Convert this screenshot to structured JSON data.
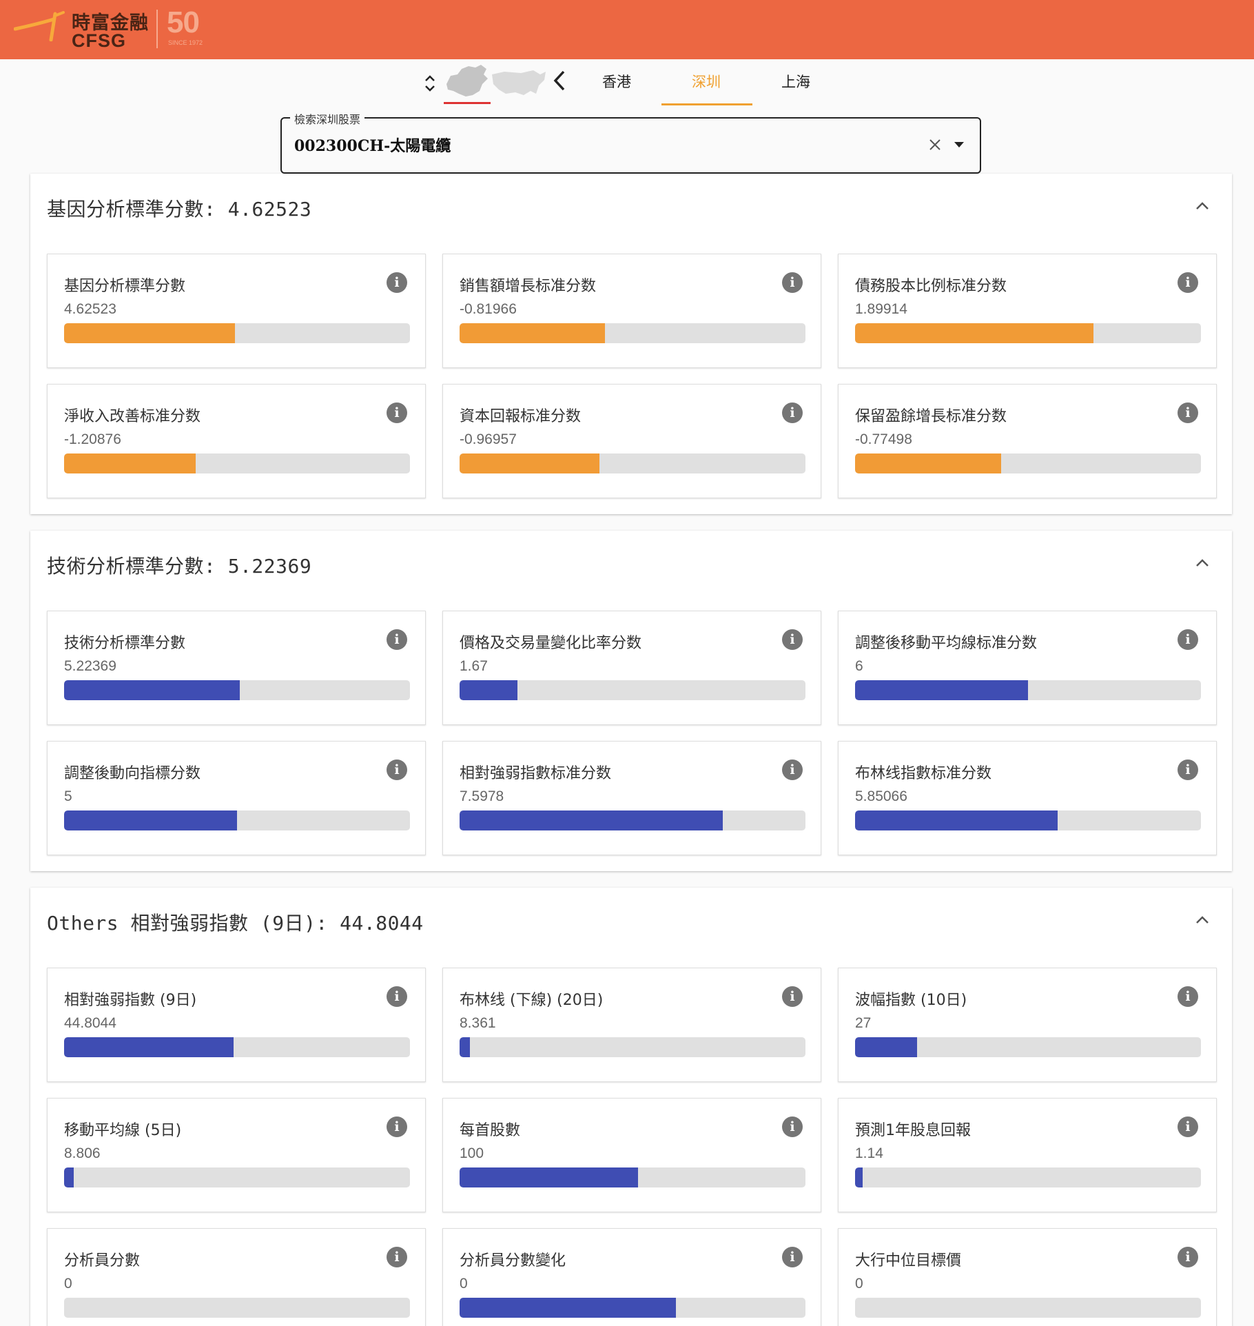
{
  "header": {
    "logo_cn": "時富金融",
    "logo_en": "CFSG",
    "logo_50": "50",
    "logo_since": "SINCE 1972"
  },
  "tabs": {
    "items": [
      {
        "label": "香港"
      },
      {
        "label": "深圳"
      },
      {
        "label": "上海"
      }
    ],
    "active": "深圳"
  },
  "search": {
    "legend": "檢索深圳股票",
    "value": "002300CH-太陽電纜"
  },
  "colors": {
    "header": "#ec6742",
    "accent": "#f0a030",
    "bar_orange": "#f19b36",
    "bar_blue": "#3f4db3"
  },
  "sections": [
    {
      "title": "基因分析標準分數: 4.62523",
      "bar_color": "orange",
      "cards": [
        {
          "label": "基因分析標準分數",
          "value": "4.62523",
          "fill": 0.495
        },
        {
          "label": "銷售額增長标准分数",
          "value": "-0.81966",
          "fill": 0.42
        },
        {
          "label": "債務股本比例标准分数",
          "value": "1.89914",
          "fill": 0.69
        },
        {
          "label": "淨收入改善标准分数",
          "value": "-1.20876",
          "fill": 0.38
        },
        {
          "label": "資本回報标准分数",
          "value": "-0.96957",
          "fill": 0.405
        },
        {
          "label": "保留盈餘增長标准分数",
          "value": "-0.77498",
          "fill": 0.422
        }
      ]
    },
    {
      "title": "技術分析標準分數: 5.22369",
      "bar_color": "blue",
      "cards": [
        {
          "label": "技術分析標準分數",
          "value": "5.22369",
          "fill": 0.508
        },
        {
          "label": "價格及交易量變化比率分数",
          "value": "1.67",
          "fill": 0.167
        },
        {
          "label": "調整後移動平均線标准分数",
          "value": "6",
          "fill": 0.5
        },
        {
          "label": "調整後動向指標分数",
          "value": "5",
          "fill": 0.5
        },
        {
          "label": "相對強弱指數标准分数",
          "value": "7.5978",
          "fill": 0.76
        },
        {
          "label": "布林线指數标准分数",
          "value": "5.85066",
          "fill": 0.585
        }
      ]
    },
    {
      "title": "Others 相對強弱指數 (9日): 44.8044",
      "bar_color": "blue",
      "cards": [
        {
          "label": "相對強弱指數 (9日)",
          "value": "44.8044",
          "fill": 0.49
        },
        {
          "label": "布林线 (下線) (20日)",
          "value": "8.361",
          "fill": 0.03
        },
        {
          "label": "波幅指數 (10日)",
          "value": "27",
          "fill": 0.18
        },
        {
          "label": "移動平均線 (5日)",
          "value": "8.806",
          "fill": 0.028
        },
        {
          "label": "每首股數",
          "value": "100",
          "fill": 0.515
        },
        {
          "label": "預測1年股息回報",
          "value": "1.14",
          "fill": 0.022
        },
        {
          "label": "分析員分數",
          "value": "0",
          "fill": 0
        },
        {
          "label": "分析員分數變化",
          "value": "0",
          "fill": 0.625
        },
        {
          "label": "大行中位目標價",
          "value": "0",
          "fill": 0
        }
      ]
    }
  ]
}
